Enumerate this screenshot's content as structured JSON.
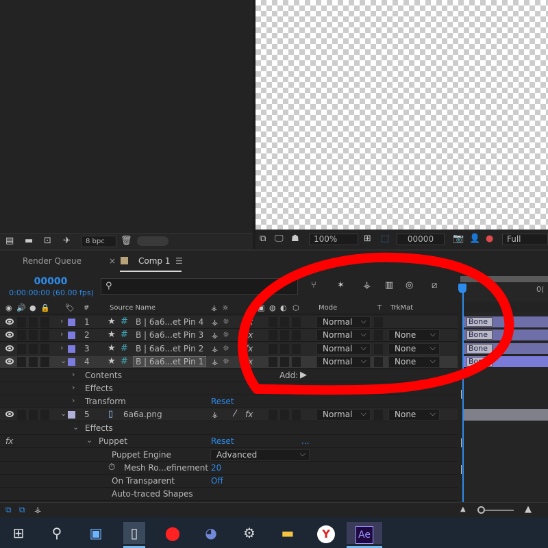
{
  "project_footer": {
    "bit_depth": "8 bpc"
  },
  "viewer_footer": {
    "zoom": "100%",
    "timecode": "00000",
    "resolution": "Full"
  },
  "tabs": {
    "render_queue": "Render Queue",
    "comp": "Comp 1",
    "close": "×",
    "menu": "☰"
  },
  "timeline": {
    "timecode": "00000",
    "timecode_sub": "0:00:00:00 (60.00 fps)",
    "search_icon": "search-icon",
    "ruler_label": "0("
  },
  "columns": {
    "hash": "#",
    "source_name": "Source Name",
    "mode": "Mode",
    "t": "T",
    "trkmat": "TrkMat"
  },
  "layers": [
    {
      "num": "1",
      "name": "B | 6a6...et Pin 4",
      "mode": "Normal",
      "trkmat": "",
      "bar": "Bone"
    },
    {
      "num": "2",
      "name": "B | 6a6...et Pin 3",
      "mode": "Normal",
      "trkmat": "None",
      "bar": "Bone"
    },
    {
      "num": "3",
      "name": "B | 6a6...et Pin 2",
      "mode": "Normal",
      "trkmat": "None",
      "bar": "Bone"
    },
    {
      "num": "4",
      "name": "B | 6a6...et Pin 1",
      "mode": "Normal",
      "trkmat": "None",
      "bar": "Bone"
    }
  ],
  "layer4_props": {
    "contents": "Contents",
    "effects": "Effects",
    "transform": "Transform",
    "reset": "Reset",
    "add_label": "Add:"
  },
  "layer5": {
    "num": "5",
    "name": "6a6a.png",
    "mode": "Normal",
    "trkmat": "None",
    "effects": "Effects",
    "puppet": "Puppet",
    "puppet_reset": "Reset",
    "puppet_dots": "...",
    "engine_label": "Puppet Engine",
    "engine_value": "Advanced",
    "mesh_label": "Mesh Ro...efinement",
    "mesh_value": "20",
    "transparent_label": "On Transparent",
    "transparent_value": "Off",
    "shapes_label": "Auto-traced Shapes"
  },
  "taskbar": {
    "ae_label": "Ae",
    "yandex_label": "Y"
  },
  "colors": {
    "accent": "#2d8ceb",
    "label_purple": "#7b7be0",
    "annotation": "#ff0000"
  }
}
